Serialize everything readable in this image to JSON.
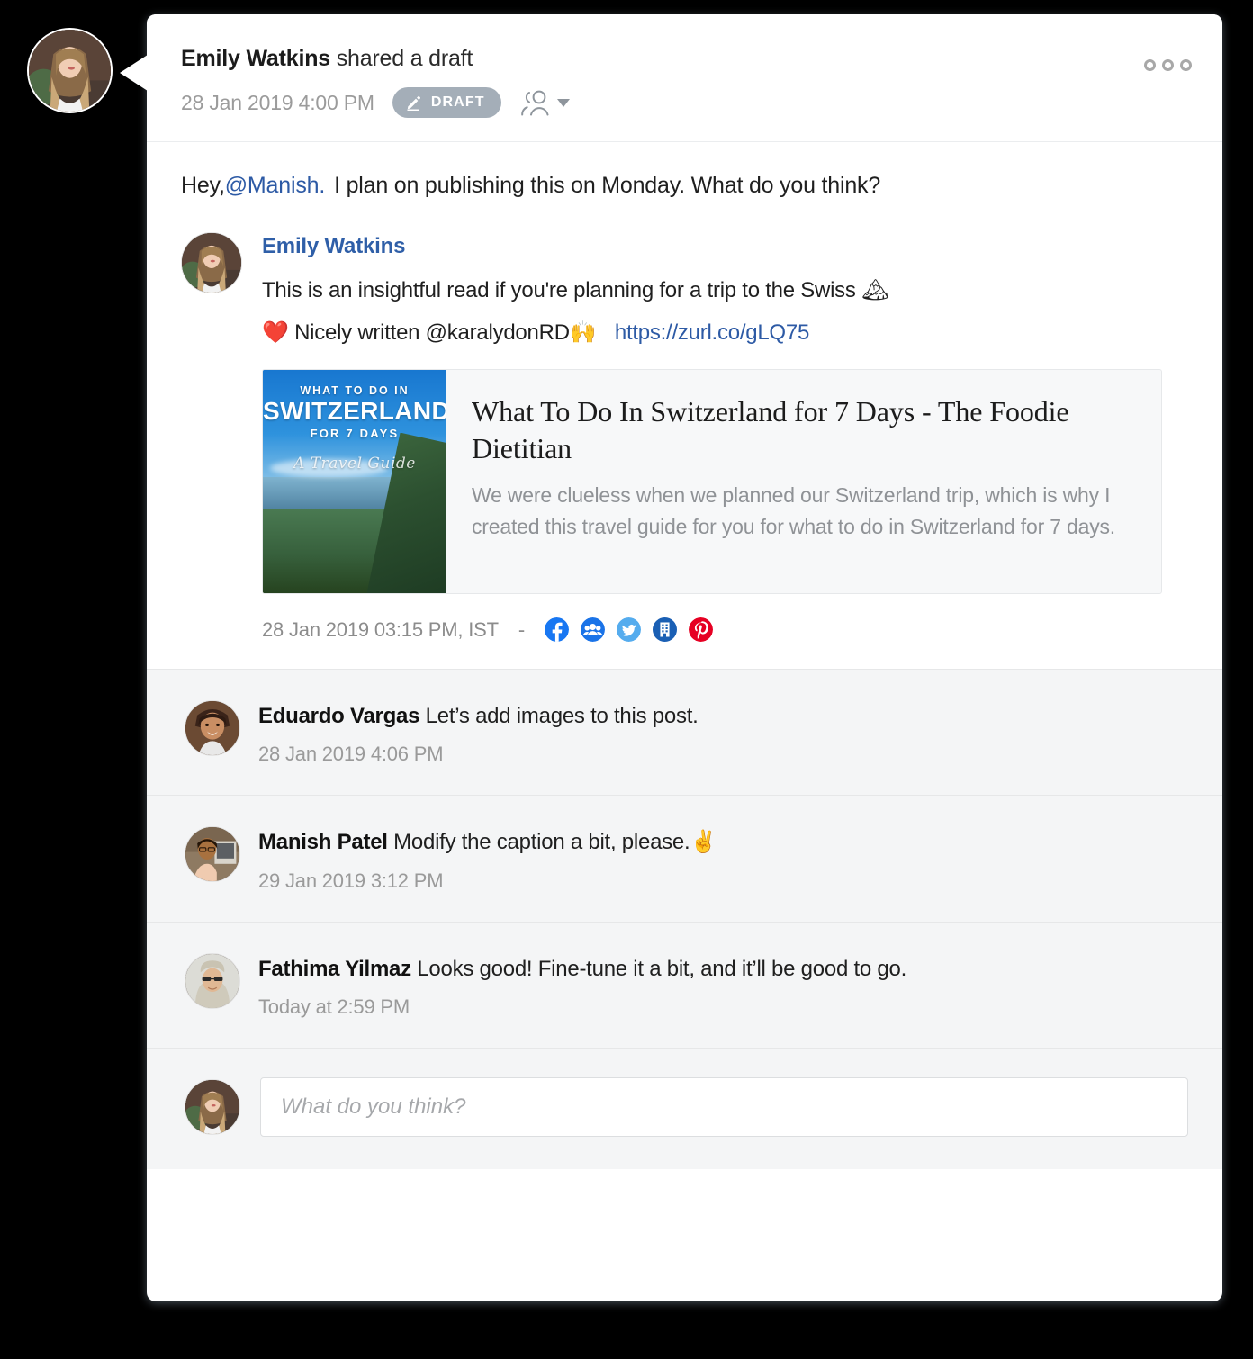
{
  "colors": {
    "page_bg": "#000000",
    "card_bg": "#ffffff",
    "comments_bg": "#f4f5f6",
    "link_blue": "#2d5aa5",
    "author_blue": "#2f5fa8",
    "muted_gray": "#9a9a9a",
    "badge_gray": "#a4aeb8",
    "preview_bg": "#f7f8f9"
  },
  "header": {
    "author": "Emily Watkins",
    "action": "shared a draft",
    "date": "28 Jan 2019 4:00 PM",
    "badge_label": "DRAFT",
    "badge_icon": "pencil-icon",
    "audience_icon": "people-icon",
    "menu_icon": "kebab-menu-icon"
  },
  "intro": {
    "prefix": "Hey,",
    "mention": "@Manish.",
    "rest": "I plan on publishing this on Monday. What do you think?"
  },
  "post": {
    "author": "Emily Watkins",
    "line1": "This is an insightful read if you're planning for a trip to the Swiss",
    "line1_emoji": "🏔",
    "line2_emoji": "❤️",
    "line2": "Nicely written @karalydonRD",
    "line2_emoji2": "🙌",
    "link": "https://zurl.co/gLQ75",
    "timestamp": "28 Jan 2019 03:15 PM, IST",
    "separator": "-"
  },
  "preview": {
    "thumb": {
      "line1": "WHAT TO DO IN",
      "line2": "SWITZERLAND",
      "line3": "FOR 7 DAYS",
      "line4": "A Travel Guide"
    },
    "title": "What To Do In Switzerland for 7 Days - The Foodie Dietitian",
    "description": "We were clueless when we planned our Switzerland trip, which is why I created this travel guide for you for what to do in Switzerland for 7 days."
  },
  "channels": [
    {
      "name": "facebook-icon",
      "color": "#1877f2",
      "glyph": "f"
    },
    {
      "name": "facebook-group-icon",
      "color": "#1a73e8",
      "glyph": "g"
    },
    {
      "name": "twitter-icon",
      "color": "#55acee",
      "glyph": "t"
    },
    {
      "name": "facebook-page-icon",
      "color": "#1a5fb4",
      "glyph": "p"
    },
    {
      "name": "pinterest-icon",
      "color": "#e60023",
      "glyph": "P"
    }
  ],
  "comments": [
    {
      "name": "Eduardo Vargas",
      "text": "Let’s add images to this post.",
      "time": "28 Jan 2019 4:06 PM",
      "emoji": ""
    },
    {
      "name": "Manish Patel",
      "text": "Modify the caption a bit, please.",
      "time": "29 Jan 2019 3:12 PM",
      "emoji": "✌️"
    },
    {
      "name": "Fathima Yilmaz",
      "text": "Looks good! Fine-tune it a bit, and it’ll be good to go.",
      "time": "Today at 2:59 PM",
      "emoji": ""
    }
  ],
  "reply": {
    "placeholder": "What do you think?",
    "value": ""
  }
}
